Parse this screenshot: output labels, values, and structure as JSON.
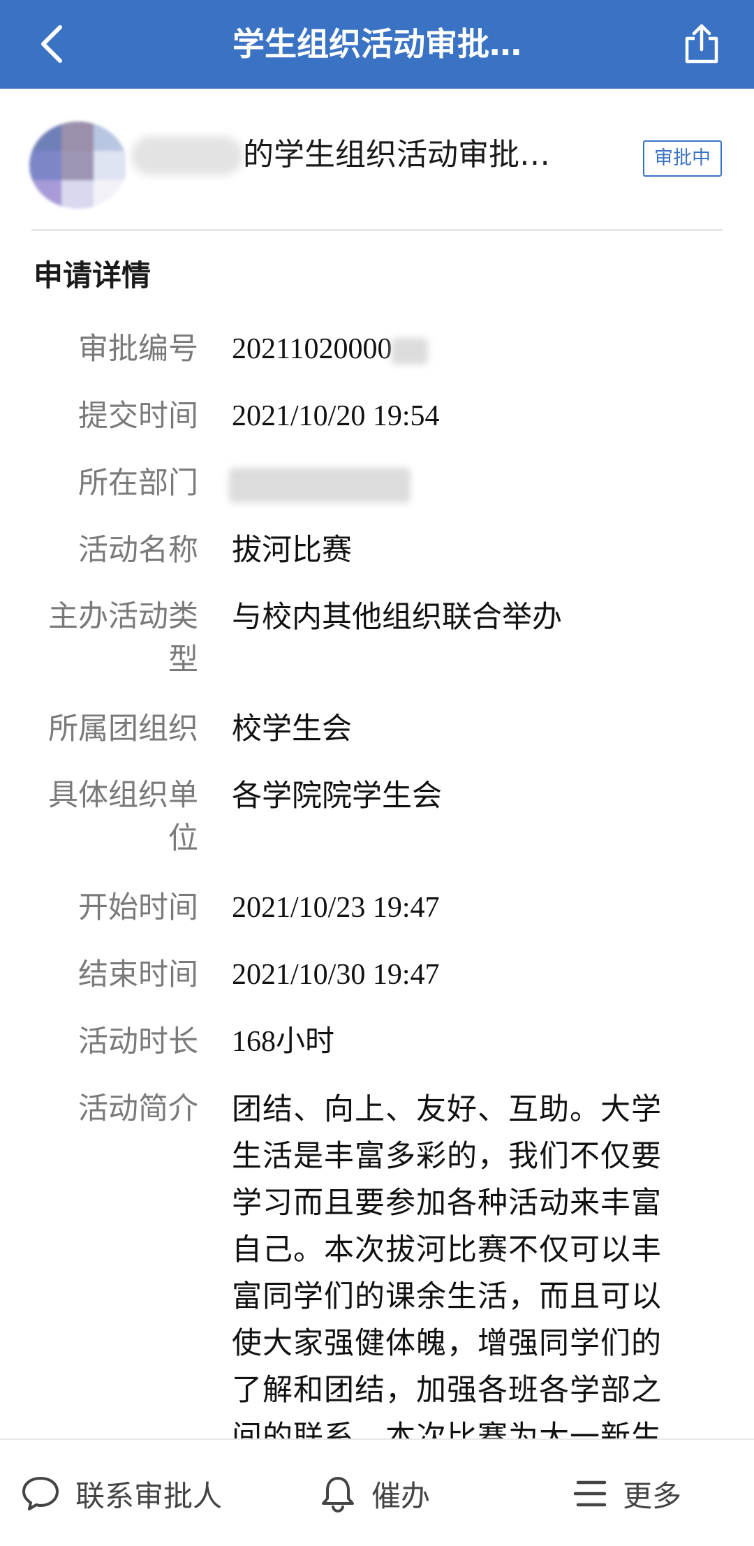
{
  "topbar": {
    "title": "学生组织活动审批…",
    "back_icon": "chevron-left-icon",
    "share_icon": "share-icon"
  },
  "header": {
    "title_suffix": "的学生组织活动审批…",
    "status": "审批中"
  },
  "section": {
    "title": "申请详情"
  },
  "details": [
    {
      "label": "审批编号",
      "value": "20211020000"
    },
    {
      "label": "提交时间",
      "value": "2021/10/20 19:54"
    },
    {
      "label": "所在部门",
      "value": ""
    },
    {
      "label": "活动名称",
      "value": "拔河比赛"
    },
    {
      "label_line1": "主办活动类",
      "label_line2": "型",
      "value": "与校内其他组织联合举办"
    },
    {
      "label": "所属团组织",
      "value": "校学生会"
    },
    {
      "label_line1": "具体组织单",
      "label_line2": "位",
      "value": "各学院院学生会"
    },
    {
      "label": "开始时间",
      "value": "2021/10/23 19:47"
    },
    {
      "label": "结束时间",
      "value": "2021/10/30 19:47"
    },
    {
      "label": "活动时长",
      "value": "168小时"
    },
    {
      "label": "活动简介",
      "lines": [
        "团结、向上、友好、互助。大学",
        "生活是丰富多彩的，我们不仅要",
        "学习而且要参加各种活动来丰富",
        "自己。本次拔河比赛不仅可以丰",
        "富同学们的课余生活，而且可以",
        "使大家强健体魄，增强同学们的",
        "了解和团结，加强各班各学部之",
        "间的联系。本次比赛为大一新生"
      ]
    }
  ],
  "bottombar": {
    "contact_label": "联系审批人",
    "urge_label": "催办",
    "more_label": "更多"
  },
  "colors": {
    "brand": "#3b73c4",
    "label_gray": "#7a7a7a"
  }
}
